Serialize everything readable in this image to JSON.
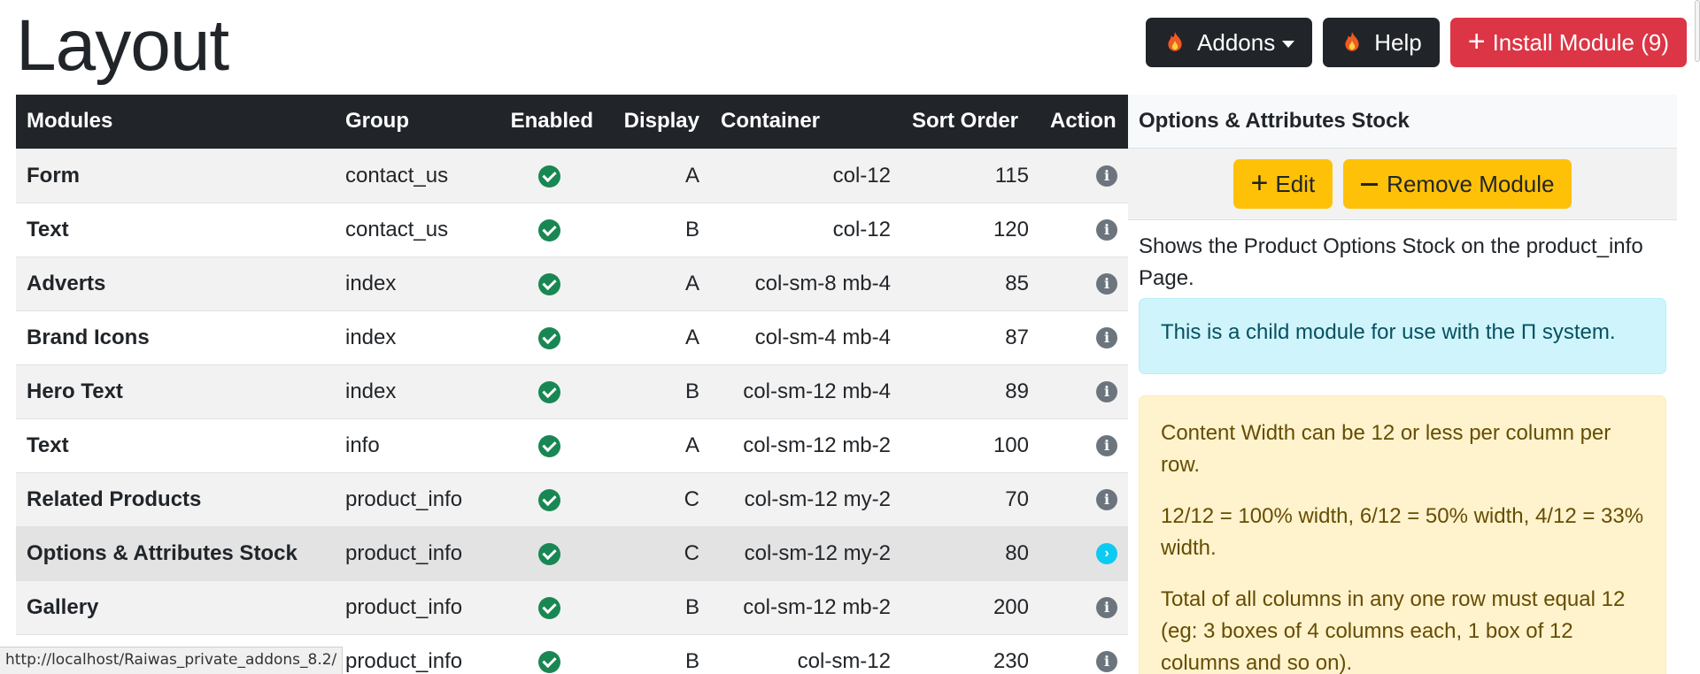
{
  "page": {
    "title": "Layout"
  },
  "toolbar": {
    "addons_label": "Addons",
    "help_label": "Help",
    "install_label": "Install Module (9)"
  },
  "table": {
    "headers": [
      "Modules",
      "Group",
      "Enabled",
      "Display",
      "Container",
      "Sort Order",
      "Action"
    ],
    "rows": [
      {
        "name": "Form",
        "group": "contact_us",
        "display": "A",
        "container": "col-12",
        "sort": "115"
      },
      {
        "name": "Text",
        "group": "contact_us",
        "display": "B",
        "container": "col-12",
        "sort": "120"
      },
      {
        "name": "Adverts",
        "group": "index",
        "display": "A",
        "container": "col-sm-8 mb-4",
        "sort": "85"
      },
      {
        "name": "Brand Icons",
        "group": "index",
        "display": "A",
        "container": "col-sm-4 mb-4",
        "sort": "87"
      },
      {
        "name": "Hero Text",
        "group": "index",
        "display": "B",
        "container": "col-sm-12 mb-4",
        "sort": "89"
      },
      {
        "name": "Text",
        "group": "info",
        "display": "A",
        "container": "col-sm-12 mb-2",
        "sort": "100"
      },
      {
        "name": "Related Products",
        "group": "product_info",
        "display": "C",
        "container": "col-sm-12 my-2",
        "sort": "70"
      },
      {
        "name": "Options & Attributes Stock",
        "group": "product_info",
        "display": "C",
        "container": "col-sm-12 my-2",
        "sort": "80"
      },
      {
        "name": "Gallery",
        "group": "product_info",
        "display": "B",
        "container": "col-sm-12 mb-2",
        "sort": "200"
      },
      {
        "name": "",
        "group": "product_info",
        "display": "B",
        "container": "col-sm-12",
        "sort": "230"
      }
    ]
  },
  "side_panel": {
    "title": "Options & Attributes Stock",
    "edit_label": "Edit",
    "remove_label": "Remove Module",
    "description": "Shows the Product Options Stock on the product_info Page.",
    "info_alert": "This is a child module for use with the Π system.",
    "warning_paragraphs": [
      "Content Width can be 12 or less per column per row.",
      "12/12 = 100% width, 6/12 = 50% width, 4/12 = 33% width.",
      "Total of all columns in any one row must equal 12 (eg: 3 boxes of 4 columns each, 1 box of 12 columns and so on)."
    ]
  },
  "status_bar": {
    "url": "http://localhost/Raiwas_private_addons_8.2/"
  },
  "colors": {
    "dark": "#212529",
    "danger": "#dc3545",
    "warning": "#ffc107",
    "success": "#198754",
    "info": "#0dcaf0"
  }
}
